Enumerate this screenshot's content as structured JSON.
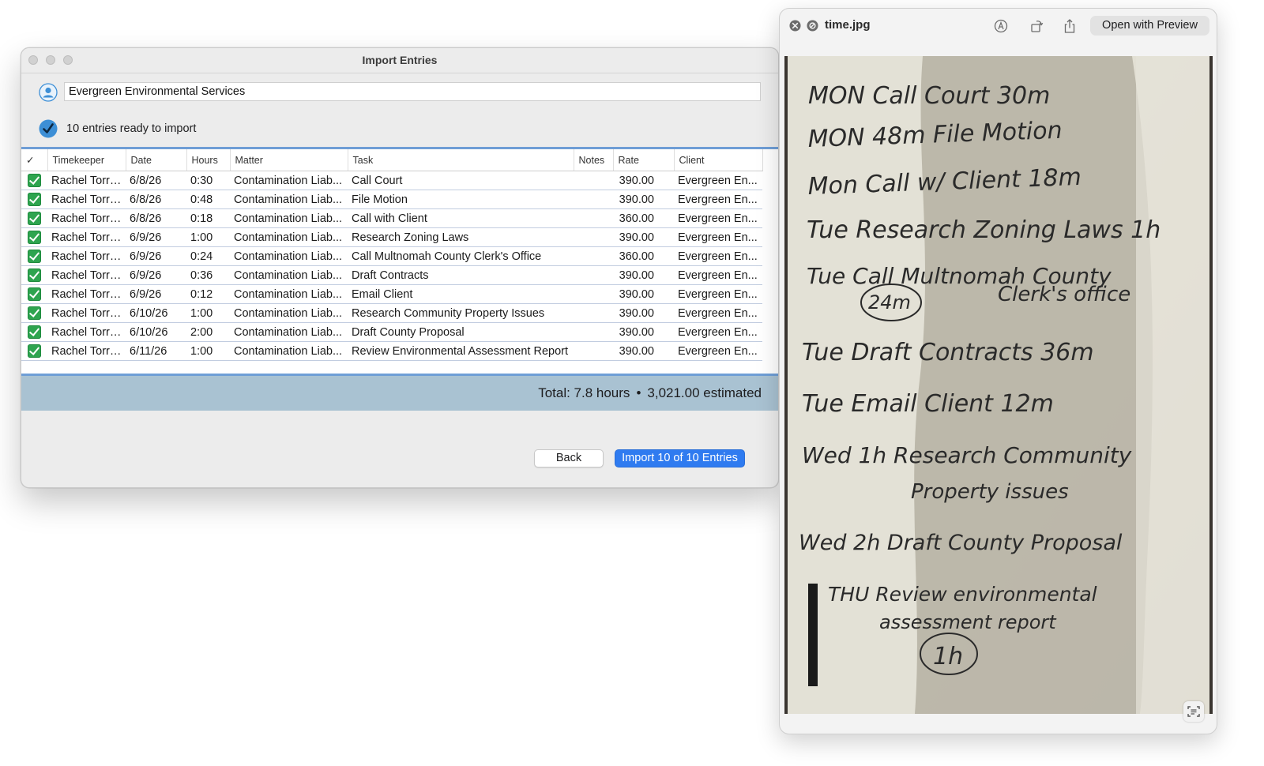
{
  "dialog": {
    "title": "Import Entries",
    "client_name": "Evergreen Environmental Services",
    "ready_text": "10 entries ready to import",
    "columns": {
      "check": "✓",
      "timekeeper": "Timekeeper",
      "date": "Date",
      "hours": "Hours",
      "matter": "Matter",
      "task": "Task",
      "notes": "Notes",
      "rate": "Rate",
      "client": "Client"
    },
    "rows": [
      {
        "timekeeper": "Rachel Torres",
        "date": "6/8/26",
        "hours": "0:30",
        "matter": "Contamination Liab...",
        "task": "Call Court",
        "notes": "",
        "rate": "390.00",
        "client": "Evergreen En..."
      },
      {
        "timekeeper": "Rachel Torres",
        "date": "6/8/26",
        "hours": "0:48",
        "matter": "Contamination Liab...",
        "task": "File Motion",
        "notes": "",
        "rate": "390.00",
        "client": "Evergreen En..."
      },
      {
        "timekeeper": "Rachel Torres",
        "date": "6/8/26",
        "hours": "0:18",
        "matter": "Contamination Liab...",
        "task": "Call with Client",
        "notes": "",
        "rate": "360.00",
        "client": "Evergreen En..."
      },
      {
        "timekeeper": "Rachel Torres",
        "date": "6/9/26",
        "hours": "1:00",
        "matter": "Contamination Liab...",
        "task": "Research Zoning Laws",
        "notes": "",
        "rate": "390.00",
        "client": "Evergreen En..."
      },
      {
        "timekeeper": "Rachel Torres",
        "date": "6/9/26",
        "hours": "0:24",
        "matter": "Contamination Liab...",
        "task": "Call Multnomah County Clerk's Office",
        "notes": "",
        "rate": "360.00",
        "client": "Evergreen En..."
      },
      {
        "timekeeper": "Rachel Torres",
        "date": "6/9/26",
        "hours": "0:36",
        "matter": "Contamination Liab...",
        "task": "Draft Contracts",
        "notes": "",
        "rate": "390.00",
        "client": "Evergreen En..."
      },
      {
        "timekeeper": "Rachel Torres",
        "date": "6/9/26",
        "hours": "0:12",
        "matter": "Contamination Liab...",
        "task": "Email Client",
        "notes": "",
        "rate": "390.00",
        "client": "Evergreen En..."
      },
      {
        "timekeeper": "Rachel Torres",
        "date": "6/10/26",
        "hours": "1:00",
        "matter": "Contamination Liab...",
        "task": "Research Community Property Issues",
        "notes": "",
        "rate": "390.00",
        "client": "Evergreen En..."
      },
      {
        "timekeeper": "Rachel Torres",
        "date": "6/10/26",
        "hours": "2:00",
        "matter": "Contamination Liab...",
        "task": "Draft County Proposal",
        "notes": "",
        "rate": "390.00",
        "client": "Evergreen En..."
      },
      {
        "timekeeper": "Rachel Torres",
        "date": "6/11/26",
        "hours": "1:00",
        "matter": "Contamination Liab...",
        "task": "Review Environmental Assessment Report",
        "notes": "",
        "rate": "390.00",
        "client": "Evergreen En..."
      }
    ],
    "total": {
      "hours_text": "Total: 7.8 hours",
      "separator": "•",
      "estimate_text": "3,021.00 estimated"
    },
    "buttons": {
      "back": "Back",
      "import": "Import 10 of 10 Entries"
    },
    "colors": {
      "accent": "#2f7bf0",
      "checkbox": "#2ea44f",
      "total_bar": "#a9c2d2",
      "table_border": "#6f9ed6"
    }
  },
  "quicklook": {
    "filename": "time.jpg",
    "open_button": "Open with Preview",
    "icons": [
      "close-icon",
      "block-icon",
      "markup-icon",
      "rotate-icon",
      "share-icon",
      "live-text-icon"
    ],
    "handwriting": [
      "MON Call Court 30m",
      "MON 48m File Motion",
      "Mon Call w/ Client 18m",
      "Tue Research Zoning Laws 1h",
      "Tue Call Multnomah County",
      "24m",
      "Clerk's office",
      "Tue Draft Contracts 36m",
      "Tue Email Client 12m",
      "Wed 1h Research Community",
      "Property issues",
      "Wed 2h Draft County Proposal",
      "THU Review environmental",
      "assessment report",
      "1h"
    ]
  }
}
